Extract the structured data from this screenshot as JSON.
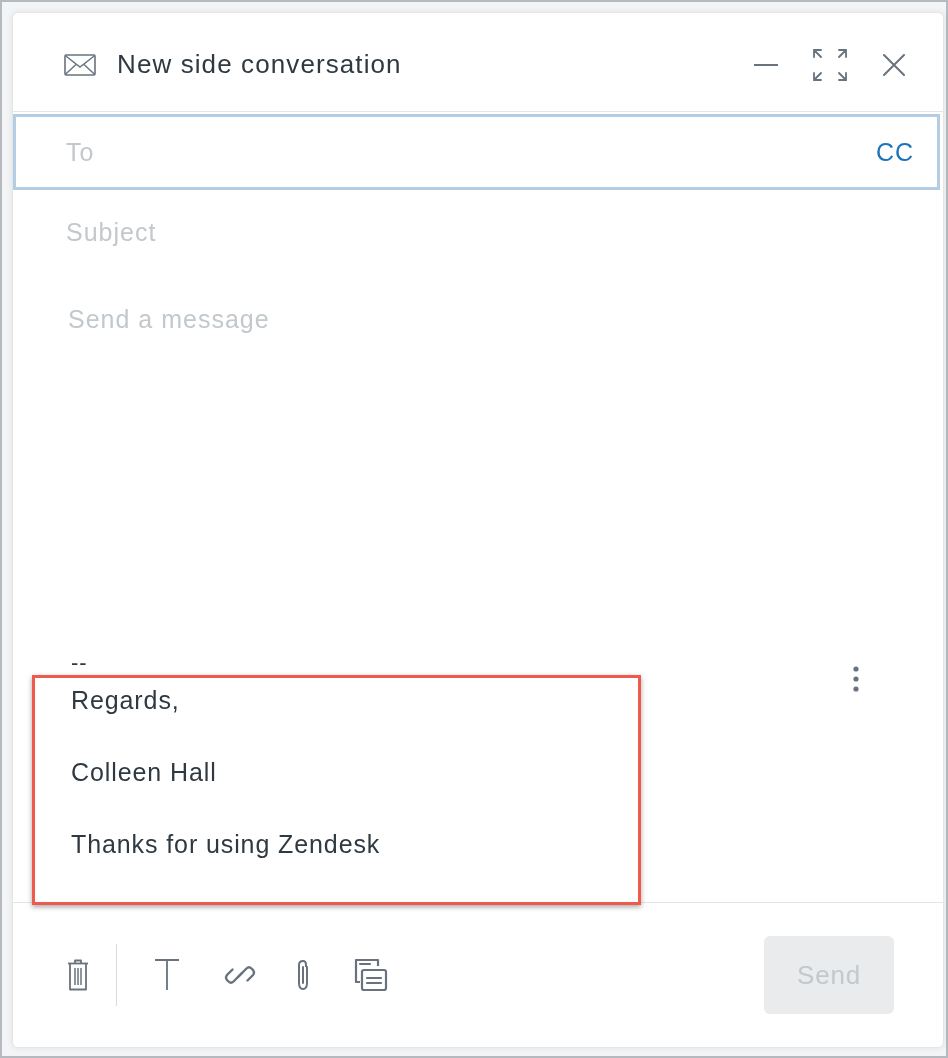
{
  "window": {
    "title": "New side conversation"
  },
  "to_field": {
    "placeholder": "To",
    "focused": true,
    "cc_label": "CC"
  },
  "subject_field": {
    "placeholder": "Subject"
  },
  "message_field": {
    "placeholder": "Send a message"
  },
  "signature": {
    "separator": "--",
    "highlighted": true,
    "lines": [
      "Regards,",
      "Colleen Hall",
      "Thanks for using Zendesk"
    ]
  },
  "send_button": {
    "label": "Send",
    "disabled": true
  }
}
